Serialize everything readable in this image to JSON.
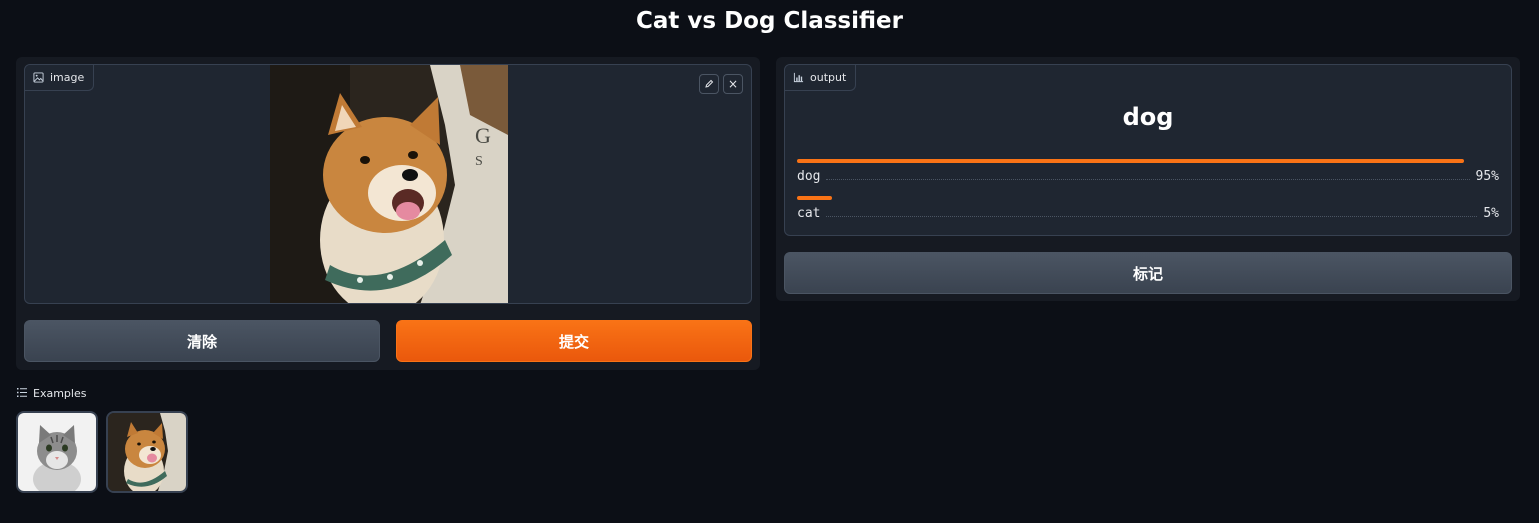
{
  "page": {
    "title": "Cat vs Dog Classifier"
  },
  "input": {
    "label": "image",
    "icon": "image-icon",
    "actions": [
      {
        "icon": "pencil-icon"
      },
      {
        "icon": "close-icon",
        "glyph": "×"
      }
    ]
  },
  "buttons": {
    "clear": "清除",
    "submit": "提交",
    "flag": "标记"
  },
  "output": {
    "label": "output",
    "icon": "bar-chart-icon",
    "predicted": "dog",
    "confidences": [
      {
        "label": "dog",
        "value": 0.95,
        "display": "95%"
      },
      {
        "label": "cat",
        "value": 0.05,
        "display": "5%"
      }
    ]
  },
  "examples": {
    "header": "Examples",
    "items": [
      {
        "name": "cat-example"
      },
      {
        "name": "dog-example"
      }
    ]
  },
  "colors": {
    "accent": "#f97316",
    "background": "#0c0f16",
    "panel": "#161a22",
    "box": "#1f2631"
  }
}
